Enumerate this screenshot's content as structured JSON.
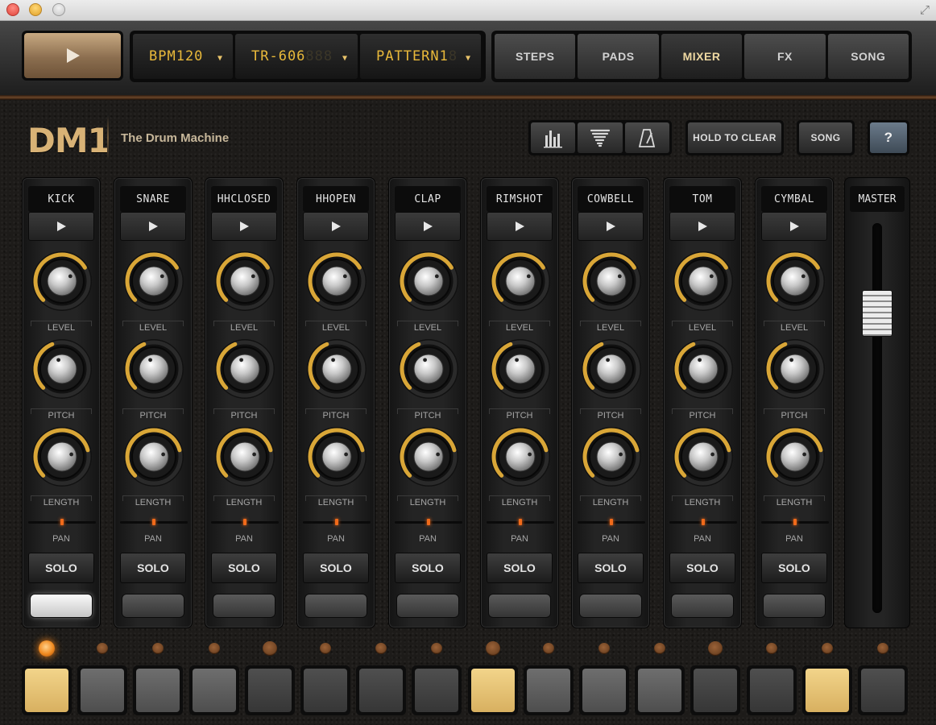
{
  "window": {
    "title": ""
  },
  "transport": {
    "play_label": ""
  },
  "lcd": {
    "bpm": {
      "text": "BPM120",
      "ghost": ""
    },
    "kit": {
      "text": "TR-606",
      "ghost": "888"
    },
    "pattern": {
      "text": "PATTERN1",
      "ghost": "8"
    }
  },
  "tabs": [
    {
      "label": "STEPS",
      "active": false
    },
    {
      "label": "PADS",
      "active": false
    },
    {
      "label": "MIXER",
      "active": true
    },
    {
      "label": "FX",
      "active": false
    },
    {
      "label": "SONG",
      "active": false
    }
  ],
  "brand": {
    "logo": "DM1",
    "subtitle": "The Drum Machine"
  },
  "toolbar": {
    "icons": [
      "equalizer-icon",
      "tornado-icon",
      "metronome-icon"
    ],
    "hold_to_clear": "HOLD TO CLEAR",
    "song": "SONG",
    "help": "?"
  },
  "mixer": {
    "labels": {
      "level": "LEVEL",
      "pitch": "PITCH",
      "length": "LENGTH",
      "pan": "PAN",
      "solo": "SOLO"
    },
    "channels": [
      {
        "name": "KICK",
        "level": 0.72,
        "pitch": 0.42,
        "length": 0.78,
        "pan": 0.5,
        "mute_lit": true
      },
      {
        "name": "SNARE",
        "level": 0.72,
        "pitch": 0.42,
        "length": 0.78,
        "pan": 0.5,
        "mute_lit": false
      },
      {
        "name": "HHCLOSED",
        "level": 0.72,
        "pitch": 0.42,
        "length": 0.78,
        "pan": 0.5,
        "mute_lit": false
      },
      {
        "name": "HHOPEN",
        "level": 0.72,
        "pitch": 0.42,
        "length": 0.78,
        "pan": 0.5,
        "mute_lit": false
      },
      {
        "name": "CLAP",
        "level": 0.72,
        "pitch": 0.42,
        "length": 0.78,
        "pan": 0.5,
        "mute_lit": false
      },
      {
        "name": "RIMSHOT",
        "level": 0.72,
        "pitch": 0.42,
        "length": 0.78,
        "pan": 0.5,
        "mute_lit": false
      },
      {
        "name": "COWBELL",
        "level": 0.72,
        "pitch": 0.42,
        "length": 0.78,
        "pan": 0.5,
        "mute_lit": false
      },
      {
        "name": "TOM",
        "level": 0.72,
        "pitch": 0.42,
        "length": 0.78,
        "pan": 0.5,
        "mute_lit": false
      },
      {
        "name": "CYMBAL",
        "level": 0.72,
        "pitch": 0.42,
        "length": 0.78,
        "pan": 0.5,
        "mute_lit": false
      }
    ],
    "master": {
      "name": "MASTER",
      "level": 0.82
    }
  },
  "steps": {
    "leds": [
      "lit",
      "off",
      "off",
      "off",
      "beat",
      "off",
      "off",
      "off",
      "beat",
      "off",
      "off",
      "off",
      "beat",
      "off",
      "off",
      "off"
    ],
    "pads": [
      "on",
      "light",
      "light",
      "light",
      "dark",
      "dark",
      "dark",
      "dark",
      "on",
      "light",
      "light",
      "light",
      "dark",
      "dark",
      "on",
      "dark"
    ]
  },
  "colors": {
    "accent": "#e9b93a",
    "knob_arc": "#d9a637",
    "pad_on": "#e8c677",
    "led_active": "#f08a20"
  }
}
